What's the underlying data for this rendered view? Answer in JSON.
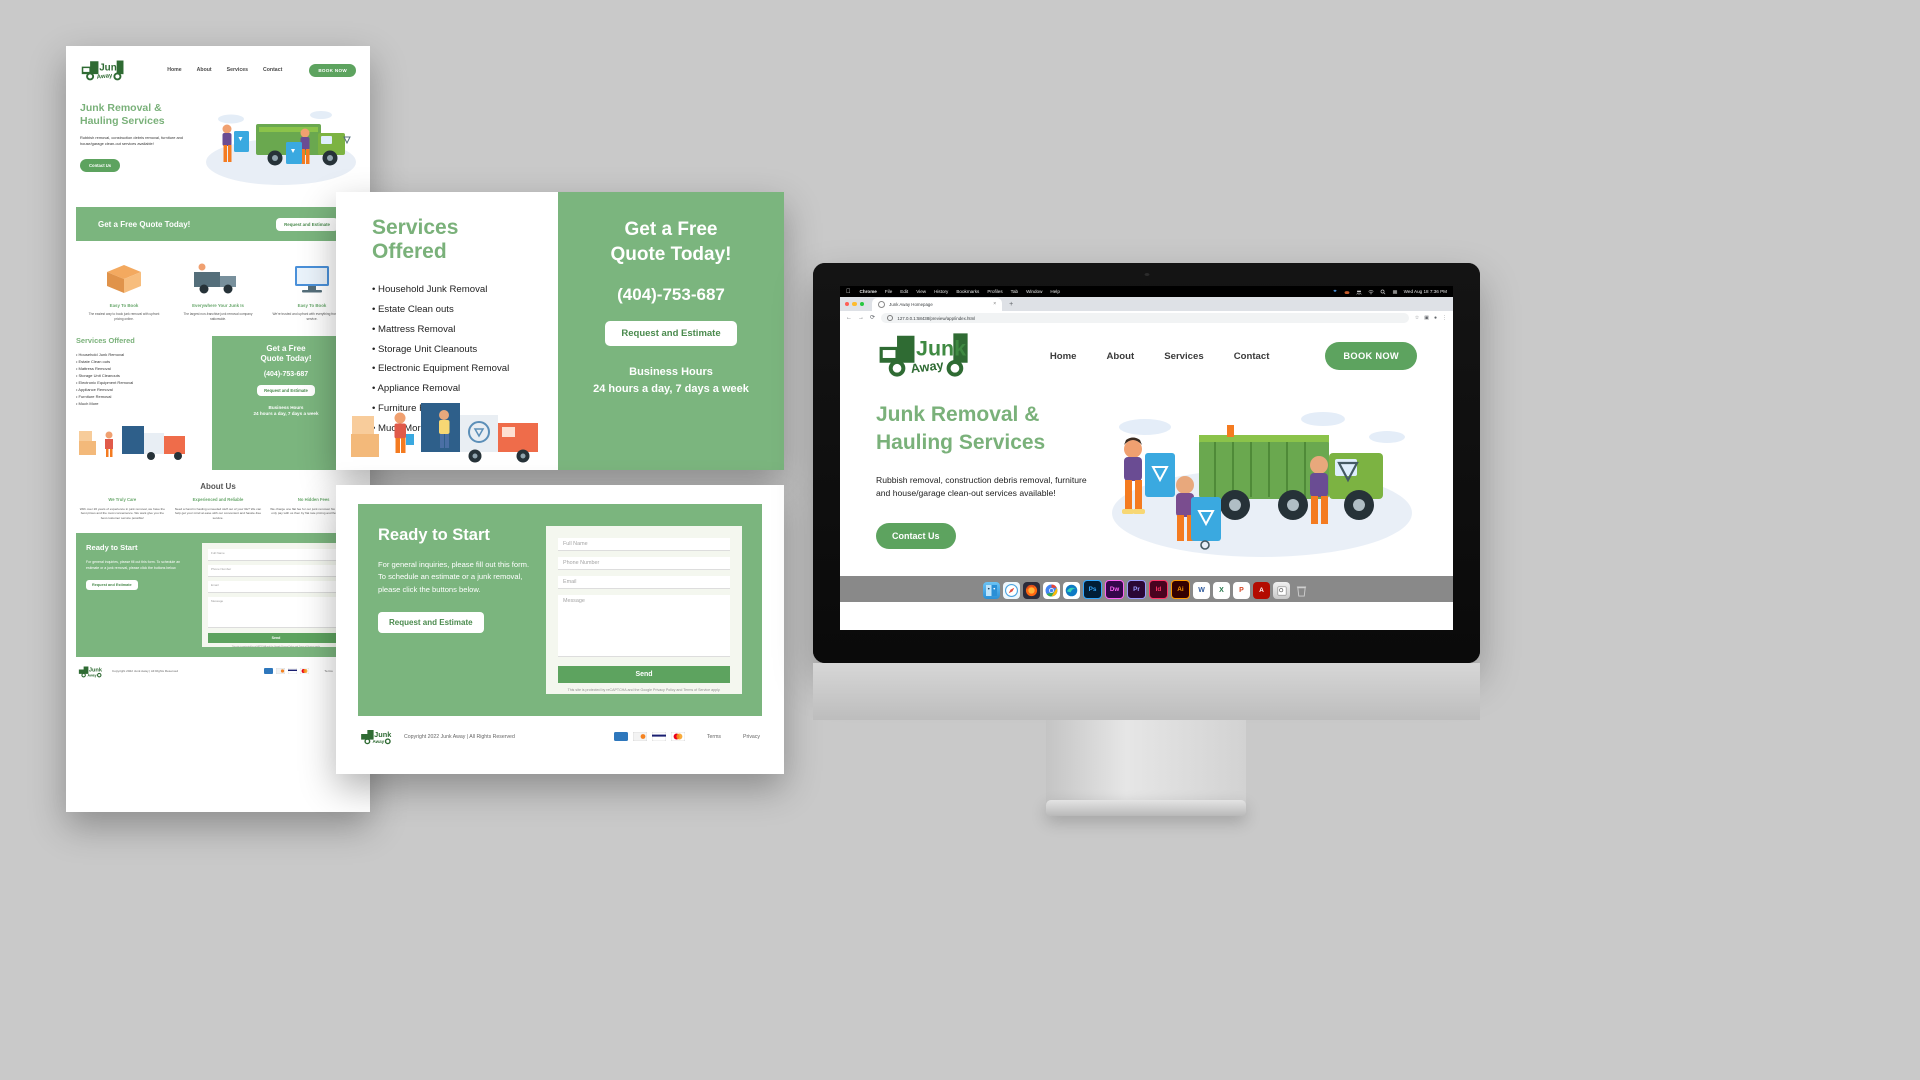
{
  "brand": {
    "name": "Junk Away",
    "logo_top": "Junk",
    "logo_bottom": "Away",
    "green": "#7bb57e",
    "dark_green": "#2f6b33",
    "button_green": "#5da35f",
    "heading_green": "#7ab17a"
  },
  "nav": {
    "items": [
      "Home",
      "About",
      "Services",
      "Contact"
    ],
    "cta": "BOOK NOW"
  },
  "hero": {
    "title_line1": "Junk Removal &",
    "title_line2": "Hauling Services",
    "subtitle": "Rubbish removal, construction debris removal, furniture and house/garage clean-out services available!",
    "cta": "Contact Us"
  },
  "quote_bar": {
    "headline": "Get a Free Quote Today!",
    "button": "Request and Estimate"
  },
  "features": [
    {
      "icon": "box-icon",
      "title": "Easy To Book",
      "text": "The easiest way to book junk removal with upfront pricing online."
    },
    {
      "icon": "truck-icon",
      "title": "Everywhere Your Junk Is",
      "text": "The largest non-franchise junk removal company nationwide."
    },
    {
      "icon": "monitor-icon",
      "title": "Easy To Book",
      "text": "We're trusted and upfront with everything from pricing to service."
    }
  ],
  "services": {
    "heading": "Services Offered",
    "items": [
      "Household Junk Removal",
      "Estate Clean outs",
      "Mattress Removal",
      "Storage Unit Cleanouts",
      "Electronic Equipment Removal",
      "Appliance Removal",
      "Furniture Removal",
      "Much More"
    ]
  },
  "quote_panel": {
    "title_line1": "Get a Free",
    "title_line2": "Quote Today!",
    "phone": "(404)-753-687",
    "button": "Request and Estimate",
    "hours_label": "Business Hours",
    "hours_value": "24 hours a day, 7 days a week"
  },
  "about": {
    "heading": "About Us",
    "columns": [
      {
        "title": "We Truly Care",
        "text": "With over 20 years of experience in junk removal, we have the best prices and the most convenience. We want give you the best customer service possible!"
      },
      {
        "title": "Experienced and Reliable",
        "text": "Need a hand in hauling unneeded stuff out of your life? We can help get your mind at ease with our convenient and hassle-free service."
      },
      {
        "title": "No Hidden Fees",
        "text": "We charge one flat fee for our junk removal. No exclusions; you only pay with us then by flat rate pricing and flexible schedule."
      }
    ]
  },
  "ready": {
    "heading": "Ready to Start",
    "text": "For general inquiries, please fill out this form. To schedule an estimate or a junk removal, please click the buttons below.",
    "button": "Request and Estimate",
    "form": {
      "full_name_placeholder": "Full Name",
      "phone_placeholder": "Phone Number",
      "email_placeholder": "Email",
      "message_placeholder": "Message",
      "send_label": "Send",
      "recaptcha_note": "This site is protected by reCAPTCHA and the Google Privacy Policy and Terms of Service apply."
    }
  },
  "footer": {
    "copyright": "Copyright 2022 Junk Away | All Rights Reserved",
    "payment_icons": [
      "amex-icon",
      "discover-icon",
      "visa-icon",
      "mastercard-icon"
    ],
    "links": [
      "Terms",
      "Privacy"
    ]
  },
  "desktop": {
    "menubar": {
      "apple": "apple-icon",
      "items": [
        "Chrome",
        "File",
        "Edit",
        "View",
        "History",
        "Bookmarks",
        "Profiles",
        "Tab",
        "Window",
        "Help"
      ],
      "status_icons": [
        "dropbox-icon",
        "cloud-icon",
        "users-icon",
        "wifi-icon",
        "search-icon",
        "control-center-icon"
      ],
      "clock": "Wed Aug 18  7:36 PM"
    },
    "browser": {
      "tab_title": "Junk Away Homepage",
      "tab_close": "×",
      "new_tab": "+",
      "back": "←",
      "forward": "→",
      "reload": "⟳",
      "url_host": "127.0.0.1:58438",
      "url_path": "/preview/app/index.html",
      "url_full": "127.0.0.1:58438/preview/app/index.html"
    },
    "dock": [
      {
        "name": "finder-icon",
        "label": "",
        "bg": "#2a9df4"
      },
      {
        "name": "safari-icon",
        "label": "",
        "bg": "#e8f4fd"
      },
      {
        "name": "firefox-icon",
        "label": "",
        "bg": "#2b2b3a"
      },
      {
        "name": "chrome-icon",
        "label": "",
        "bg": "#f5f5f5"
      },
      {
        "name": "edge-icon",
        "label": "",
        "bg": "#ffffff"
      },
      {
        "name": "photoshop-icon",
        "label": "Ps",
        "bg": "#001e36"
      },
      {
        "name": "dreamweaver-icon",
        "label": "Dw",
        "bg": "#35064a"
      },
      {
        "name": "premiere-icon",
        "label": "Pr",
        "bg": "#2a0634"
      },
      {
        "name": "indesign-icon",
        "label": "Id",
        "bg": "#49021f"
      },
      {
        "name": "illustrator-icon",
        "label": "Ai",
        "bg": "#330000"
      },
      {
        "name": "word-icon",
        "label": "W",
        "bg": "#ffffff"
      },
      {
        "name": "excel-icon",
        "label": "X",
        "bg": "#ffffff"
      },
      {
        "name": "powerpoint-icon",
        "label": "P",
        "bg": "#ffffff"
      },
      {
        "name": "acrobat-icon",
        "label": "A",
        "bg": "#b30b00"
      },
      {
        "name": "preview-icon",
        "label": "",
        "bg": "#d8d8d8"
      },
      {
        "name": "trash-icon",
        "label": "",
        "bg": "#9a9a9a"
      }
    ]
  }
}
